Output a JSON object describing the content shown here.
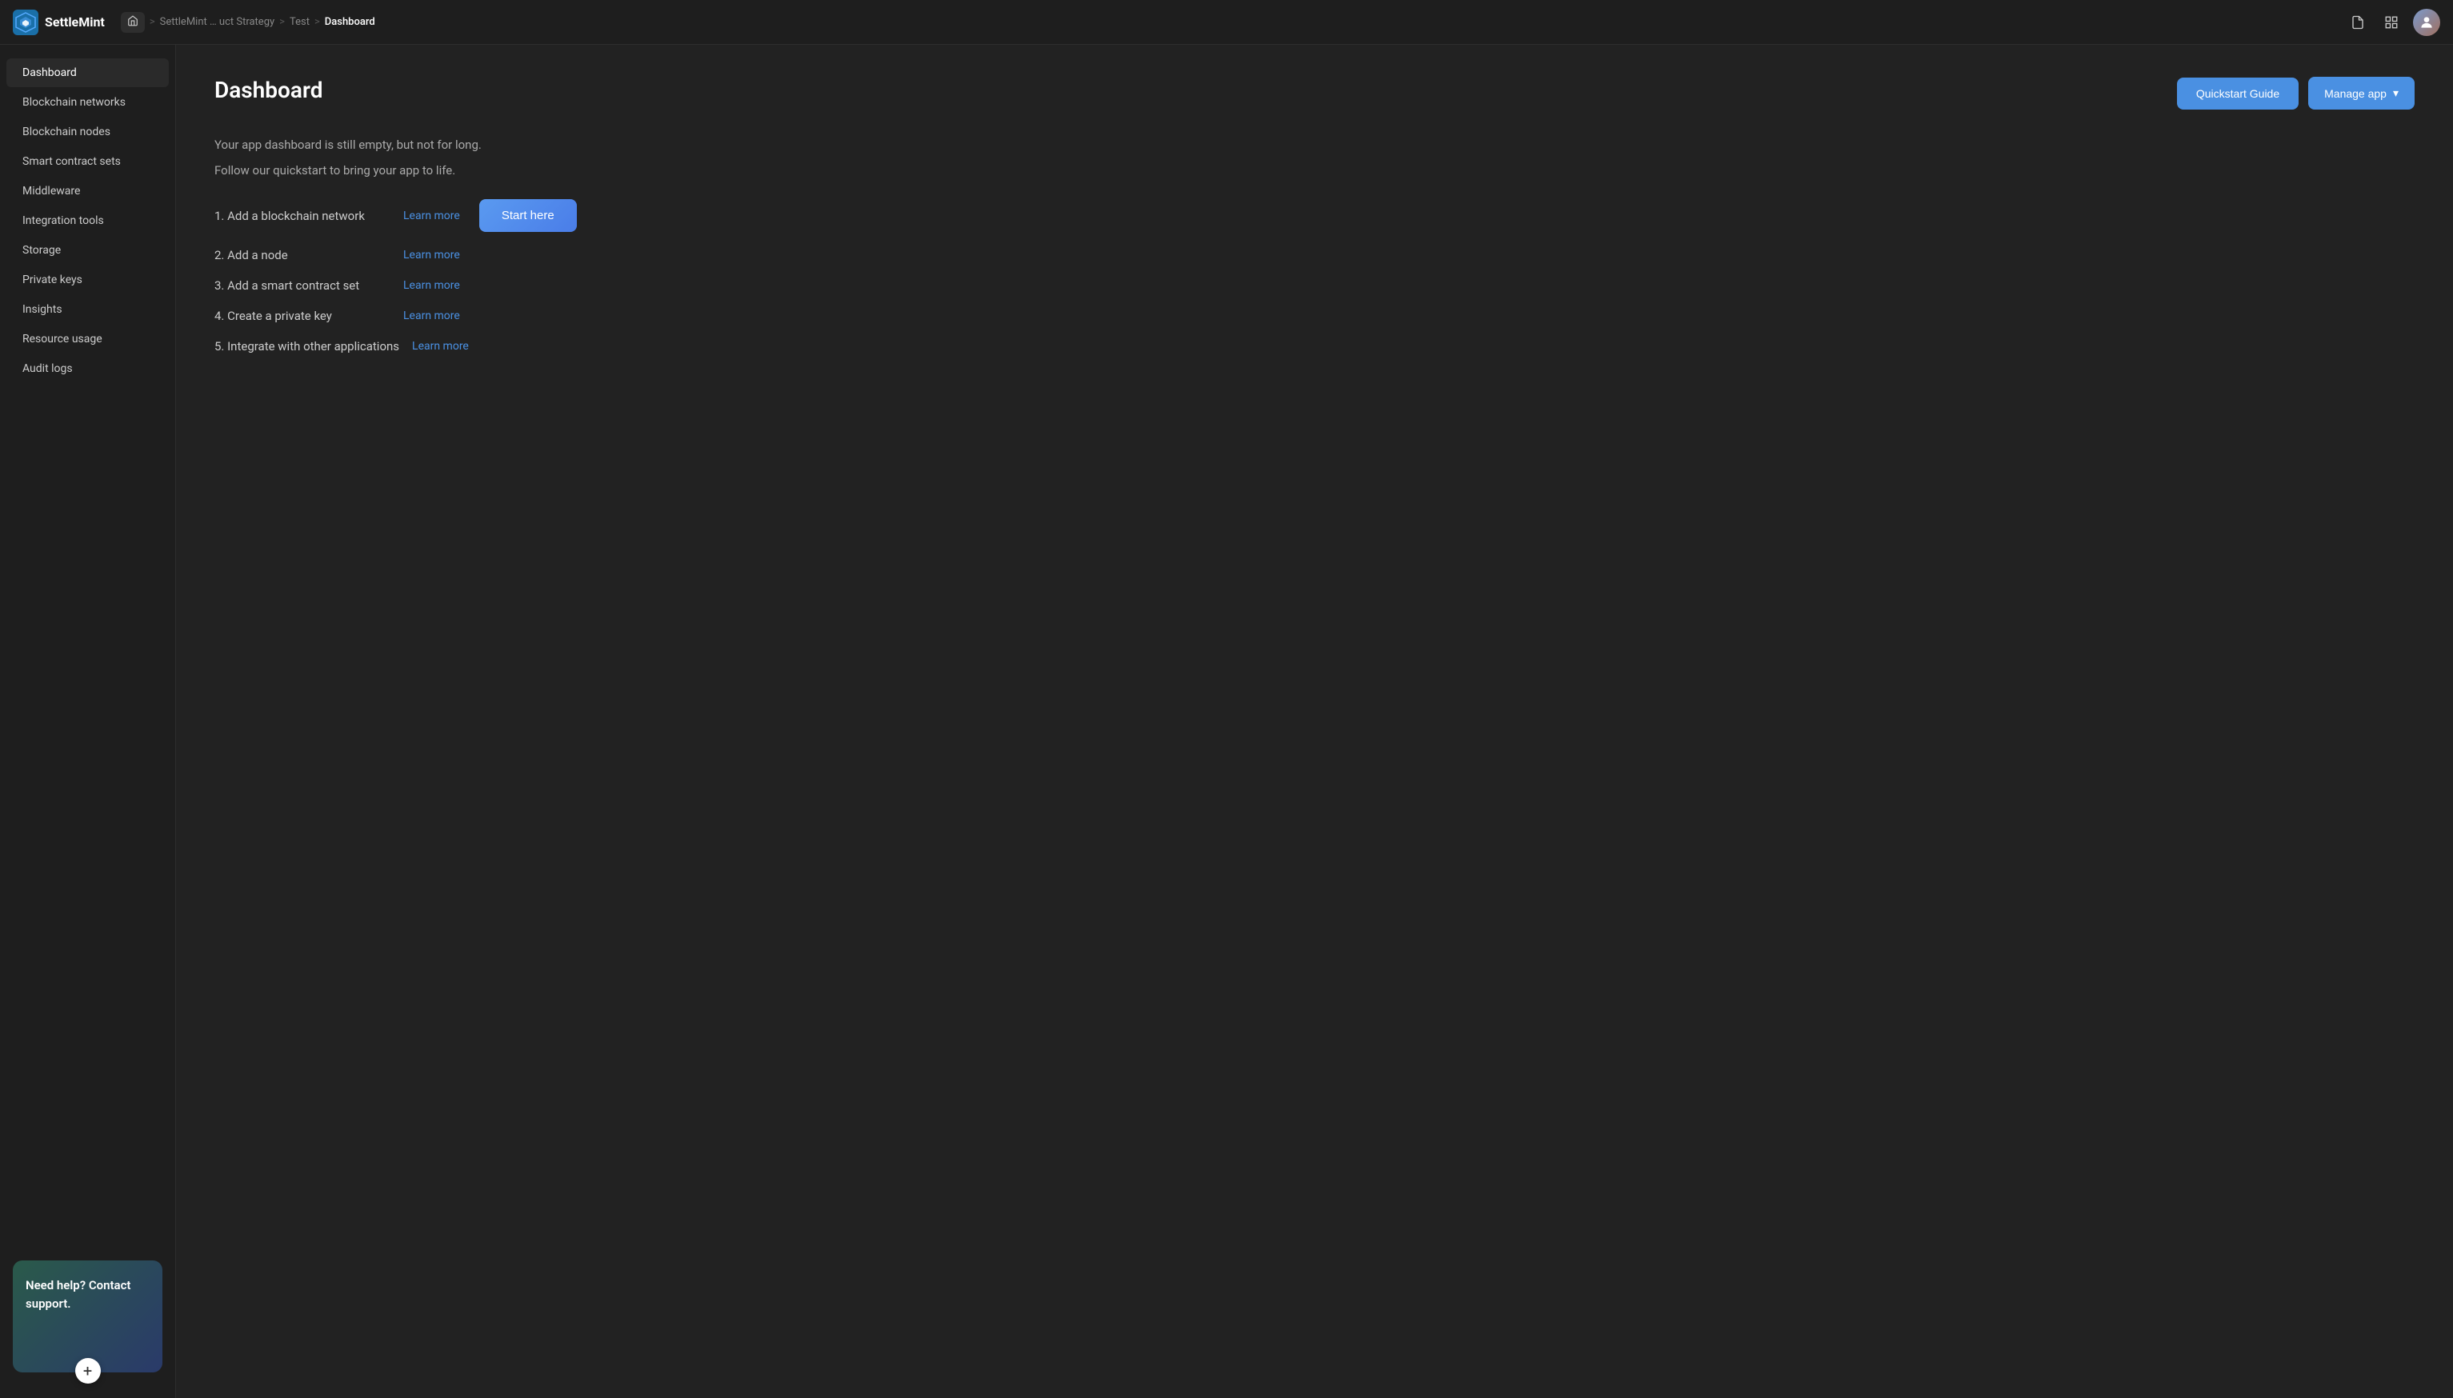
{
  "app": {
    "name": "SettleMint"
  },
  "navbar": {
    "breadcrumb": {
      "home_label": "⌂",
      "sep1": ">",
      "item1": "SettleMint … uct Strategy",
      "sep2": ">",
      "item2": "Test",
      "sep3": ">",
      "current": "Dashboard"
    }
  },
  "sidebar": {
    "items": [
      {
        "id": "dashboard",
        "label": "Dashboard",
        "active": true
      },
      {
        "id": "blockchain-networks",
        "label": "Blockchain networks",
        "active": false
      },
      {
        "id": "blockchain-nodes",
        "label": "Blockchain nodes",
        "active": false
      },
      {
        "id": "smart-contract-sets",
        "label": "Smart contract sets",
        "active": false
      },
      {
        "id": "middleware",
        "label": "Middleware",
        "active": false
      },
      {
        "id": "integration-tools",
        "label": "Integration tools",
        "active": false
      },
      {
        "id": "storage",
        "label": "Storage",
        "active": false
      },
      {
        "id": "private-keys",
        "label": "Private keys",
        "active": false
      },
      {
        "id": "insights",
        "label": "Insights",
        "active": false
      },
      {
        "id": "resource-usage",
        "label": "Resource usage",
        "active": false
      },
      {
        "id": "audit-logs",
        "label": "Audit logs",
        "active": false
      }
    ],
    "help_card": {
      "text": "Need help? Contact support.",
      "btn_label": "+"
    }
  },
  "main": {
    "page_title": "Dashboard",
    "empty_message_1": "Your app dashboard is still empty, but not for long.",
    "empty_message_2": "Follow our quickstart to bring your app to life.",
    "steps": [
      {
        "id": 1,
        "text": "1. Add a blockchain network",
        "link_label": "Learn more"
      },
      {
        "id": 2,
        "text": "2. Add a node",
        "link_label": "Learn more"
      },
      {
        "id": 3,
        "text": "3. Add a smart contract set",
        "link_label": "Learn more"
      },
      {
        "id": 4,
        "text": "4. Create a private key",
        "link_label": "Learn more"
      },
      {
        "id": 5,
        "text": "5. Integrate with other applications",
        "link_label": "Learn more"
      }
    ],
    "start_button": "Start here",
    "quickstart_button": "Quickstart Guide",
    "manage_button": "Manage app",
    "manage_chevron": "▾"
  }
}
